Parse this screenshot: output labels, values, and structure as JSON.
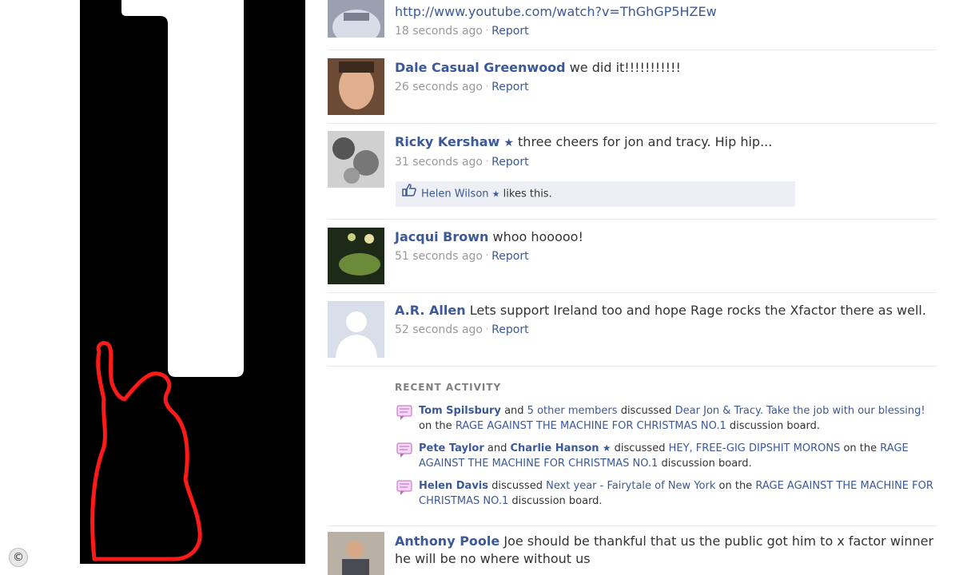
{
  "stories": [
    {
      "name": "",
      "star": false,
      "text": "",
      "link": "http://www.youtube.com/watch?v=ThGhGP5HZEw",
      "time": "18 seconds ago",
      "report": "Report"
    },
    {
      "name": "Dale Casual Greenwood",
      "star": false,
      "text": "we did it!!!!!!!!!!!",
      "time": "26 seconds ago",
      "report": "Report"
    },
    {
      "name": "Ricky Kershaw",
      "star": true,
      "text": "three cheers for jon and tracy. Hip hip...",
      "time": "31 seconds ago",
      "report": "Report",
      "likes": {
        "name": "Helen Wilson",
        "suffix": "likes this."
      }
    },
    {
      "name": "Jacqui Brown",
      "star": false,
      "text": "whoo hooooo!",
      "time": "51 seconds ago",
      "report": "Report"
    },
    {
      "name": "A.R. Allen",
      "star": false,
      "text": "Lets support Ireland too and hope Rage rocks the Xfactor there as well.",
      "time": "52 seconds ago",
      "report": "Report"
    },
    {
      "name": "Anthony Poole",
      "star": false,
      "text": "Joe should be thankful that us the public got him to x factor winner he will be no where without us",
      "time": "",
      "report": ""
    }
  ],
  "recent_activity": {
    "title": "RECENT ACTIVITY",
    "items": [
      {
        "actor1": "Tom Spilsbury",
        "and": "and",
        "others": "5 other members",
        "verb": "discussed",
        "topic": "Dear Jon & Tracy. Take the job with our blessing!",
        "on": "on the",
        "board": "RAGE AGAINST THE MACHINE FOR CHRISTMAS NO.1",
        "suffix": "discussion board."
      },
      {
        "actor1": "Pete Taylor",
        "and": "and",
        "actor2": "Charlie Hanson",
        "verb": "discussed",
        "topic": "HEY, FREE-GIG DIPSHIT MORONS",
        "on": "on the",
        "board": "RAGE AGAINST THE MACHINE FOR CHRISTMAS NO.1",
        "suffix": "discussion board."
      },
      {
        "actor1": "Helen Davis",
        "verb": "discussed",
        "topic": "Next year - Fairytale of New York",
        "on": "on the",
        "board": "RAGE AGAINST THE MACHINE FOR CHRISTMAS NO.1",
        "suffix": "discussion board."
      }
    ]
  },
  "icons": {
    "star": "star-icon",
    "like": "thumbs-up-icon",
    "discussion": "speech-bubble-icon",
    "copyright": "copyright-icon"
  },
  "glyphs": {
    "star": "★",
    "dot": "·",
    "copyright": "©"
  },
  "colors": {
    "link": "#3b5998",
    "meta": "#999999",
    "like_bg": "#edeff4",
    "bubble": "#c266c2",
    "poster_bg": "#000000",
    "poster_outline": "#ff1a1a"
  }
}
